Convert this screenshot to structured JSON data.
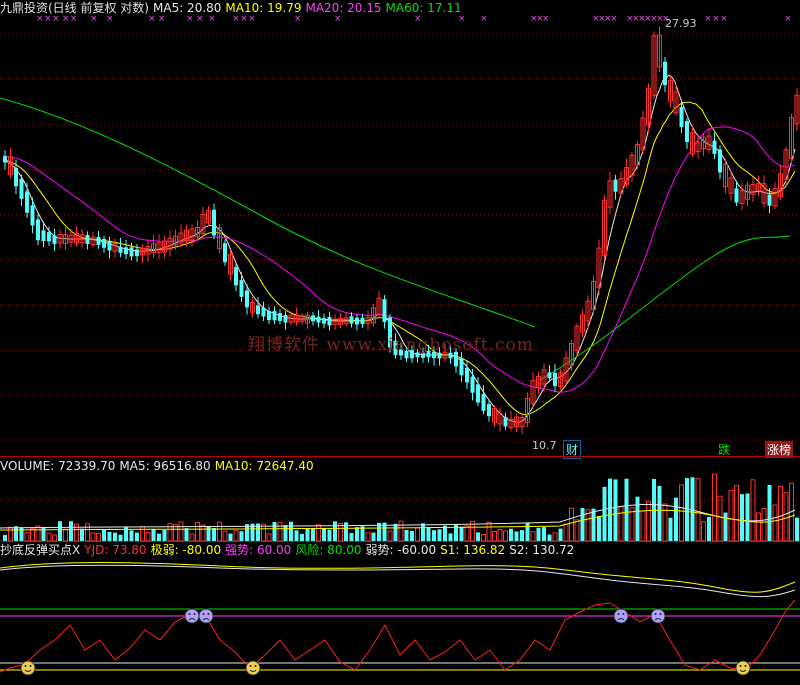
{
  "main_header": {
    "title": "九鼎投资(日线 前复权 对数)",
    "ma5_label": "MA5: 20.80",
    "ma10_label": "MA10: 19.79",
    "ma20_label": "MA20: 20.15",
    "ma60_label": "MA60: 17.11"
  },
  "annotations": {
    "high_price": "27.93",
    "low_price": "10.7",
    "finance_badge": "财",
    "fall_badge": "跌",
    "limit_up_badge": "涨榜"
  },
  "watermark": "翔博软件 www.xiangbosoft.com",
  "volume_header": {
    "volume_label": "VOLUME: 72339.70",
    "ma5_label": "MA5: 96516.80",
    "ma10_label": "MA10: 72647.40"
  },
  "indicator_header": {
    "name": "抄底反弹买点X",
    "yjd_label": "YJD: 73.80",
    "extreme_weak_label": "极弱: -80.00",
    "strong_label": "强势: 60.00",
    "risk_label": "风险: 80.00",
    "weak_label": "弱势: -60.00",
    "s1_label": "S1: 136.82",
    "s2_label": "S2: 130.72"
  },
  "colors": {
    "up": "#ff3030",
    "down": "#54fcfc",
    "ma5": "#e8e8e8",
    "ma10": "#ffff00",
    "ma20": "#ff00ff",
    "ma60": "#00e000",
    "grid": "#a00000"
  }
}
